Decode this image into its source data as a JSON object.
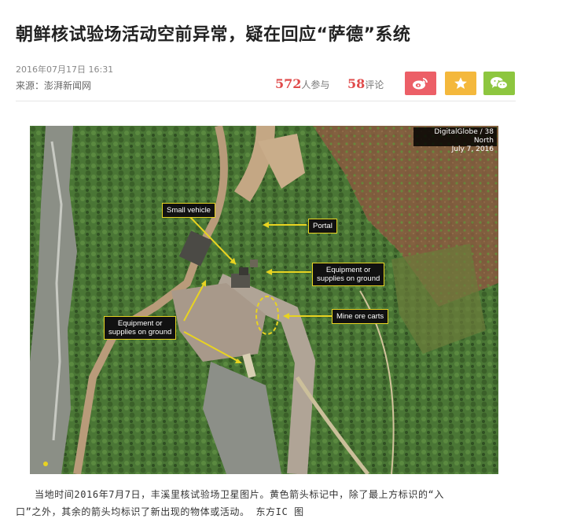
{
  "article": {
    "title": "朝鲜核试验场活动空前异常，疑在回应“萨德”系统",
    "date": "2016年07月17日  16:31",
    "source": "来源：澎湃新闻网",
    "participants_count": "572",
    "participants_label": "人参与",
    "comments_count": "58",
    "comments_label": "评论"
  },
  "share": {
    "weibo_icon": "weibo-icon",
    "favorite_icon": "star-icon",
    "wechat_icon": "wechat-icon",
    "colors": {
      "weibo": "#ec5f67",
      "favorite": "#f4b83c",
      "wechat": "#8dc63f"
    }
  },
  "image": {
    "credit_line1": "DigitalGlobe / 38 North",
    "credit_line2": "July 7, 2016",
    "labels": {
      "small_vehicle": "Small vehicle",
      "portal": "Portal",
      "equipment_right_1": "Equipment or",
      "equipment_right_2": "supplies on ground",
      "mine_ore_carts": "Mine ore carts",
      "equipment_left_1": "Equipment or",
      "equipment_left_2": "supplies on ground"
    },
    "annotation_color": "#e8d321"
  },
  "caption": {
    "line1": "当地时间2016年7月7日，丰溪里核试验场卫星图片。黄色箭头标记中，除了最上方标识的“入",
    "line2": "口”之外，其余的箭头均标识了新出现的物体或活动。 东方IC 图"
  }
}
